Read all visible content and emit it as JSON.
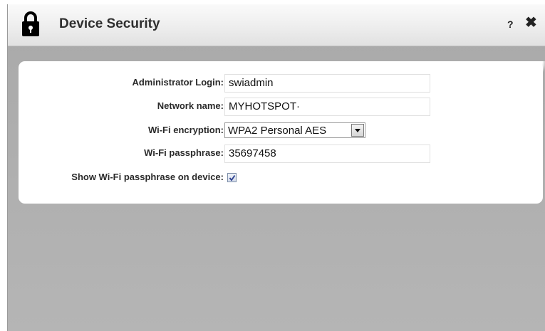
{
  "window": {
    "title": "Device Security",
    "help_label": "?",
    "close_label": "✖"
  },
  "form": {
    "admin_login": {
      "label": "Administrator Login:",
      "value": "swiadmin"
    },
    "network_name": {
      "label": "Network name:",
      "value": "MYHOTSPOT·"
    },
    "encryption": {
      "label": "Wi-Fi encryption:",
      "value": "WPA2 Personal AES"
    },
    "passphrase": {
      "label": "Wi-Fi passphrase:",
      "value": "35697458"
    },
    "show_passphrase": {
      "label": "Show Wi-Fi passphrase on device:",
      "checked": true
    }
  },
  "icons": {
    "lock": "lock-icon",
    "check": "check-icon"
  },
  "colors": {
    "background": "#b0b0b0",
    "panel": "#ffffff",
    "title_text": "#2f2f2f"
  }
}
